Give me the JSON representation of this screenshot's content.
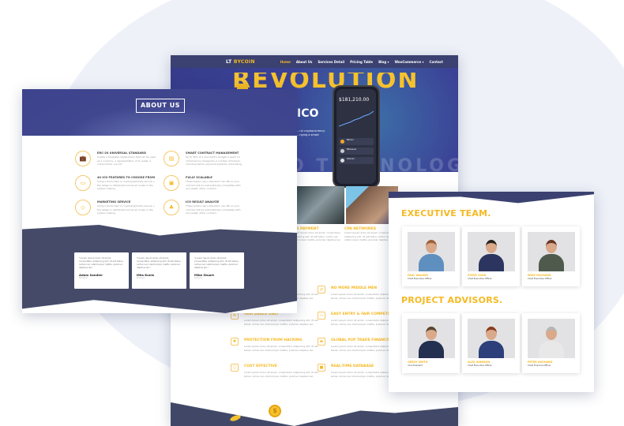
{
  "colors": {
    "accent": "#f5b923",
    "navy": "#3b4170",
    "hero": "#3b4296"
  },
  "middle_page": {
    "logo_prefix": "LT ",
    "logo_brand": "BYCOIN",
    "nav": [
      "Home",
      "About Us",
      "Services Detail",
      "Pricing Table",
      "Blog ▾",
      "WooCommerce ▾",
      "Contact"
    ],
    "hero_big": "REVOLUTION",
    "hero_title": "ICO",
    "hero_text": "...nd cryptocurrency ...nging a smart",
    "hero_bg_word": "O TECHNOLOGY",
    "phone": {
      "balance": "$181,210.00",
      "rows": [
        "Bitcoin",
        "Ethereum",
        "Litecoin"
      ]
    },
    "about": [
      {
        "kicker": "ABOUT US",
        "title": "...S PAYMENT",
        "text": "Lorem ipsum dolor sit amet, consectetur adipiscing elit. Ut elit tellus, luctus nec ullamcorper mattis, pulvinar dapibus leo."
      },
      {
        "kicker": "ABOUT US",
        "title": "CPA NETWORKS",
        "text": "Lorem ipsum dolor sit amet, consectetur adipiscing elit. Ut elit tellus, luctus nec ullamcorper mattis, pulvinar dapibus leo."
      }
    ],
    "features": [
      {
        "title": "...S",
        "icon": "★"
      },
      {
        "title": "NO MORE MIDDLE MEN",
        "icon": "⇄"
      },
      {
        "title": "FAIR DEALS ONLY",
        "icon": "⚙"
      },
      {
        "title": "EASY ENTRY & FAIR COMPETITION",
        "icon": "▭"
      },
      {
        "title": "PROTECTION FROM HACKING",
        "icon": "✱"
      },
      {
        "title": "GLOBAL P2P TRADE FINANCING",
        "icon": "▬"
      },
      {
        "title": "COST EFFECTIVE",
        "icon": "▢"
      },
      {
        "title": "REAL-TIME DATABASE",
        "icon": "■"
      }
    ],
    "feature_text": "Lorem ipsum dolor sit amet, consectetur adipiscing elit. Ut elit tellus, luctus nec ullamcorper mattis, pulvinar dapibus leo.",
    "coin_symbol": "$"
  },
  "left_page": {
    "title": "ABOUT US",
    "features": [
      {
        "title": "ERC-20 UNIVERSAL STANDARD",
        "text": "Create a tradeable digital token that can be used as a currency, a representation of an asset, a virtual share, a proof",
        "icon": "💼"
      },
      {
        "title": "SMART CONTRACT MANAGEMENT",
        "text": "Up to 40% of a merchant's budget is spent on commissions charged by a number of brokers, including banks, payment systems, advertising",
        "icon": "▤"
      },
      {
        "title": "40 ICO FEATURES TO CHOOSE FROM",
        "text": "Using a blockchain is cryptographically secure + the ledger is distributed across all nodes in the system making",
        "icon": "▭"
      },
      {
        "title": "FULLY SCALABLE",
        "text": "These tokens use a standard coin API so your contract will be automatically compatible with any wallet, other contract",
        "icon": "▣"
      },
      {
        "title": "MARKETING SERVICE",
        "text": "Using a blockchain is cryptographically secure + the ledger is distributed across all nodes in the system making",
        "icon": "◇"
      },
      {
        "title": "ICO RESULT ANALYZE",
        "text": "These tokens use a standard coin API so your contract will be automatically compatible with any wallet, other contract",
        "icon": "♣"
      }
    ],
    "testimonials": [
      {
        "quote": "\"Lorem ipsum dolor sit amet, consectetur adipiscing elit. Ut elit tellus, luctus nec ullamcorper mattis, pulvinar dapibus leo.\"",
        "name": "Adam Sandler",
        "role": "Designer"
      },
      {
        "quote": "\"Lorem ipsum dolor sit amet, consectetur adipiscing elit. Ut elit tellus, luctus nec ullamcorper mattis, pulvinar dapibus leo.\"",
        "name": "Mila Kunis",
        "role": "Manager"
      },
      {
        "quote": "\"Lorem ipsum dolor sit amet, consectetur adipiscing elit. Ut elit tellus, luctus nec ullamcorper mattis, pulvinar dapibus leo.\"",
        "name": "Mike Stuart",
        "role": "Support"
      }
    ]
  },
  "right_page": {
    "exec_title": "EXECUTIVE TEAM.",
    "exec": [
      {
        "name": "PAUL WALKER",
        "role": "Chief Executive Officer"
      },
      {
        "name": "STEVE COOK",
        "role": "Chief Executive Officer"
      },
      {
        "name": "EDDY HOCHARD",
        "role": "Chief Executive Officer"
      }
    ],
    "adv_title": "PROJECT ADVISORS.",
    "advisors": [
      {
        "name": "GREGY SMITH",
        "role": "Vice President"
      },
      {
        "name": "ALEX JOHNSON",
        "role": "Chief Executive Officer"
      },
      {
        "name": "PETER HOCHARD",
        "role": "Chief Financial Officer"
      }
    ]
  }
}
